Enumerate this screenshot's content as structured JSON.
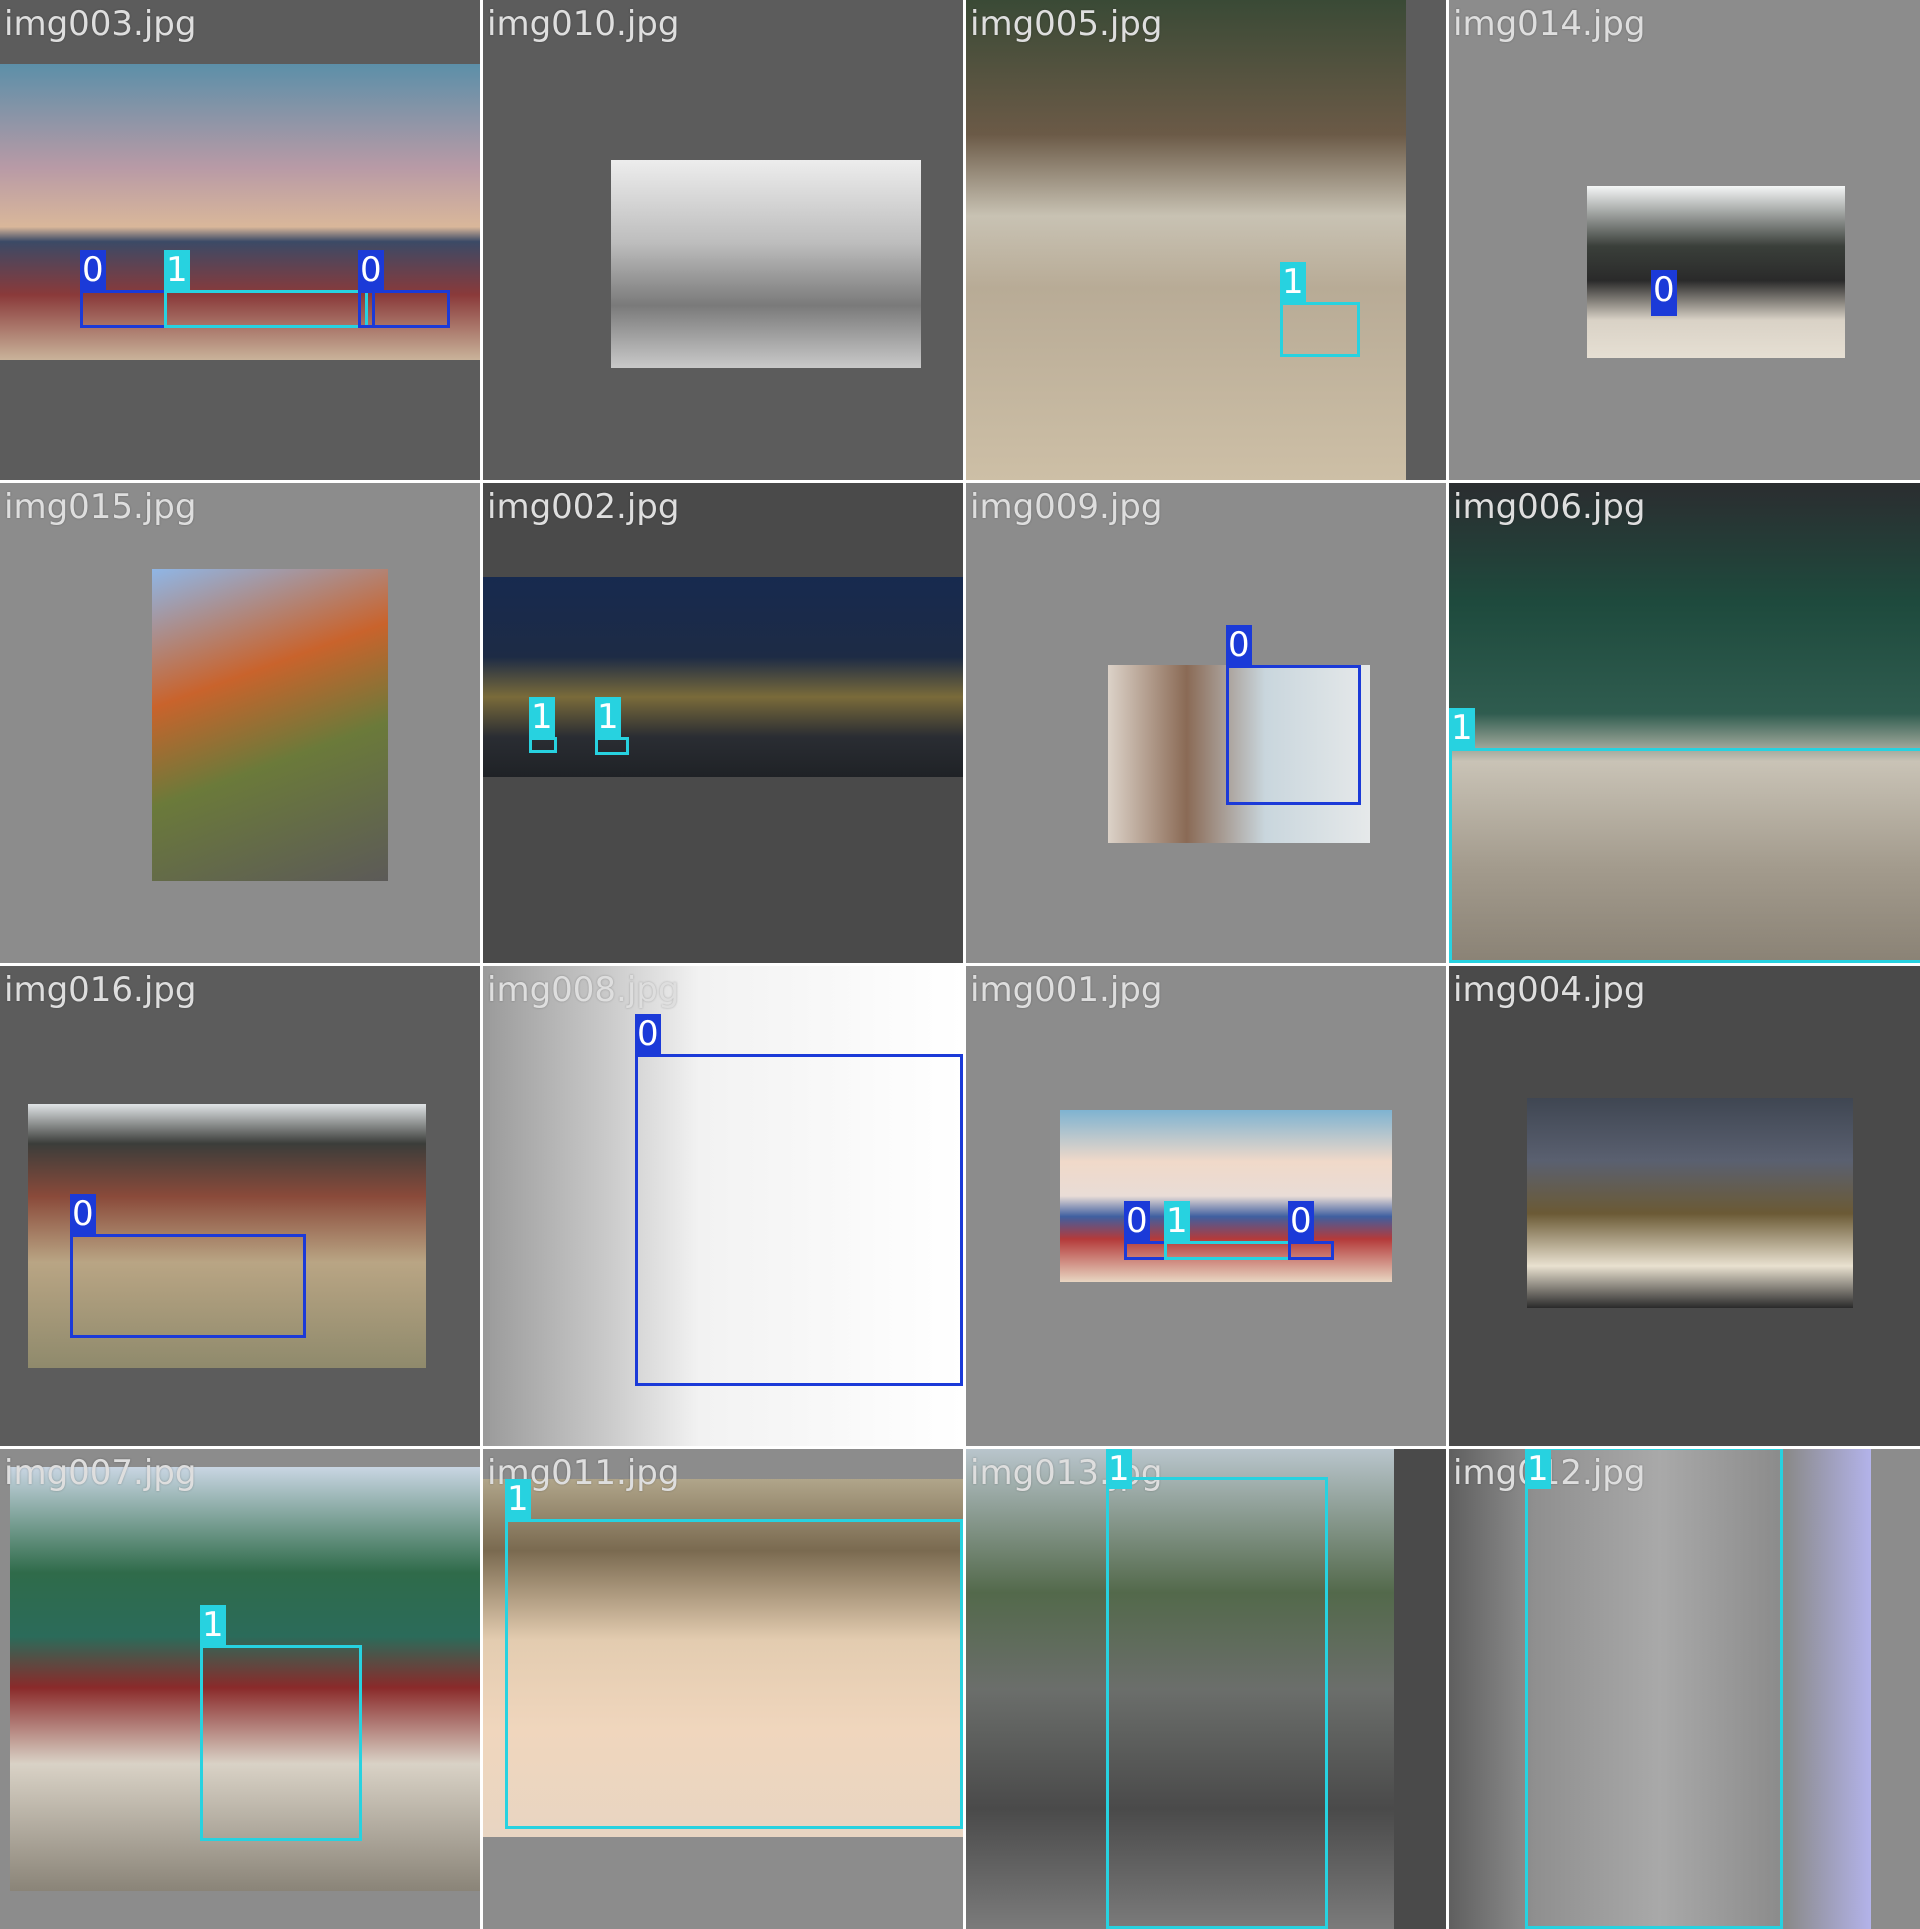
{
  "class_colors": {
    "0": "#1b3ad8",
    "1": "#27d2e0"
  },
  "tiles": [
    {
      "filename": "img003.jpg",
      "labels": [
        "0",
        "1",
        "0"
      ]
    },
    {
      "filename": "img010.jpg",
      "labels": []
    },
    {
      "filename": "img005.jpg",
      "labels": [
        "1"
      ]
    },
    {
      "filename": "img014.jpg",
      "labels": [
        "0"
      ]
    },
    {
      "filename": "img015.jpg",
      "labels": []
    },
    {
      "filename": "img002.jpg",
      "labels": [
        "1",
        "1"
      ]
    },
    {
      "filename": "img009.jpg",
      "labels": [
        "0"
      ]
    },
    {
      "filename": "img006.jpg",
      "labels": [
        "1"
      ]
    },
    {
      "filename": "img016.jpg",
      "labels": [
        "0"
      ]
    },
    {
      "filename": "img008.jpg",
      "labels": [
        "0"
      ]
    },
    {
      "filename": "img001.jpg",
      "labels": [
        "0",
        "1",
        "0"
      ]
    },
    {
      "filename": "img004.jpg",
      "labels": []
    },
    {
      "filename": "img007.jpg",
      "labels": [
        "1"
      ]
    },
    {
      "filename": "img011.jpg",
      "labels": [
        "1"
      ]
    },
    {
      "filename": "img013.jpg",
      "labels": [
        "1"
      ]
    },
    {
      "filename": "img012.jpg",
      "labels": [
        "1"
      ]
    }
  ]
}
